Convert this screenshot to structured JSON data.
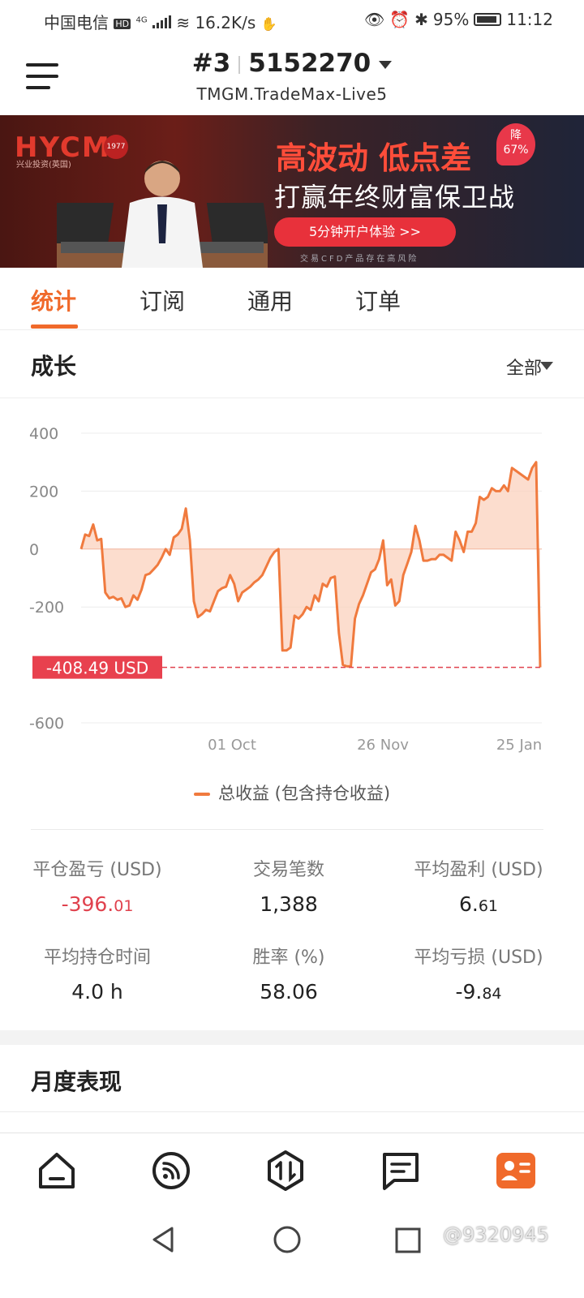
{
  "status_bar": {
    "carrier": "中国电信",
    "hd": "HD",
    "net": "4G",
    "speed": "16.2K/s",
    "battery": "95%",
    "time": "11:12"
  },
  "header": {
    "account_index": "#3",
    "account_number": "5152270",
    "server": "TMGM.TradeMax-Live5"
  },
  "banner": {
    "logo": "HYCM",
    "logo_sub": "兴业投资(英国)",
    "seal": "1977",
    "title": "高波动 低点差",
    "badge_top": "降",
    "badge_bottom": "67%",
    "subtitle": "打赢年终财富保卫战",
    "cta": "5分钟开户体验 >>",
    "risk": "交易CFD产品存在高风险"
  },
  "tabs": [
    "统计",
    "订阅",
    "通用",
    "订单"
  ],
  "active_tab": 0,
  "growth": {
    "title": "成长",
    "filter": "全部"
  },
  "chart_data": {
    "type": "area",
    "y_ticks": [
      "400",
      "200",
      "0",
      "-200",
      "-600"
    ],
    "x_ticks": [
      "01 Oct",
      "26 Nov",
      "25 Jan"
    ],
    "ylim": [
      -600,
      400
    ],
    "marker_label": "-408.49 USD",
    "marker_value": -408.49,
    "series": [
      {
        "name": "总收益 (包含持仓收益)",
        "color": "#f07a3e",
        "values": [
          0,
          50,
          45,
          85,
          30,
          35,
          -150,
          -170,
          -165,
          -175,
          -170,
          -200,
          -195,
          -160,
          -175,
          -140,
          -90,
          -85,
          -70,
          -55,
          -30,
          0,
          -20,
          40,
          50,
          70,
          140,
          30,
          -180,
          -235,
          -225,
          -210,
          -215,
          -180,
          -145,
          -135,
          -130,
          -90,
          -120,
          -180,
          -150,
          -140,
          -130,
          -115,
          -105,
          -90,
          -60,
          -30,
          -10,
          0,
          -350,
          -350,
          -340,
          -230,
          -240,
          -225,
          -200,
          -210,
          -160,
          -180,
          -120,
          -130,
          -100,
          -95,
          -290,
          -400,
          -405,
          -405,
          -240,
          -190,
          -160,
          -120,
          -80,
          -70,
          -35,
          30,
          -125,
          -105,
          -195,
          -180,
          -90,
          -50,
          -10,
          80,
          30,
          -40,
          -40,
          -35,
          -35,
          -20,
          -20,
          -30,
          -40,
          60,
          30,
          -10,
          60,
          60,
          90,
          180,
          170,
          180,
          210,
          200,
          200,
          220,
          200,
          280,
          270,
          260,
          250,
          240,
          280,
          300,
          -408
        ]
      }
    ]
  },
  "stats": [
    {
      "label": "平仓盈亏 (USD)",
      "value": "-396.",
      "value_small": "01",
      "negative": true
    },
    {
      "label": "交易笔数",
      "value": "1,388",
      "value_small": "",
      "negative": false
    },
    {
      "label": "平均盈利 (USD)",
      "value": "6.",
      "value_small": "61",
      "negative": false
    },
    {
      "label": "平均持仓时间",
      "value": "4.0 h",
      "value_small": "",
      "negative": false
    },
    {
      "label": "胜率 (%)",
      "value": "58.06",
      "value_small": "",
      "negative": false
    },
    {
      "label": "平均亏损 (USD)",
      "value": "-9.",
      "value_small": "84",
      "negative": false
    }
  ],
  "monthly": {
    "title": "月度表现"
  },
  "watermark": "@9320945",
  "accent_color": "#f06a2b",
  "loss_color": "#e0414d"
}
